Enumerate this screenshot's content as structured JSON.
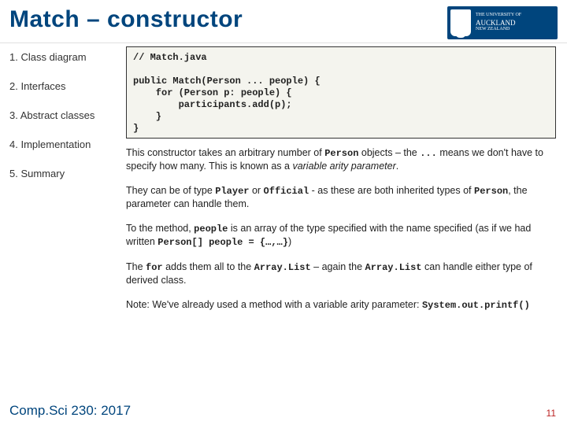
{
  "header": {
    "title": "Match – constructor",
    "logo_line1": "THE UNIVERSITY OF",
    "logo_line2": "AUCKLAND",
    "logo_line3": "NEW ZEALAND"
  },
  "sidebar": {
    "items": [
      "1. Class diagram",
      "2. Interfaces",
      "3. Abstract classes",
      "4. Implementation",
      "5. Summary"
    ]
  },
  "code": {
    "text": "// Match.java\n\npublic Match(Person ... people) {\n    for (Person p: people) {\n        participants.add(p);\n    }\n}"
  },
  "paragraphs": {
    "p1_a": "This constructor takes an arbitrary number of ",
    "p1_code1": "Person",
    "p1_b": " objects – the ",
    "p1_code2": "...",
    "p1_c": " means we don't have to specify how many. This is known as a ",
    "p1_em": "variable arity parameter",
    "p1_d": ".",
    "p2_a": "They can be of type ",
    "p2_code1": "Player",
    "p2_b": " or ",
    "p2_code2": "Official",
    "p2_c": " - as these are both inherited types of ",
    "p2_code3": "Person",
    "p2_d": ", the parameter can handle them.",
    "p3_a": "To the method, ",
    "p3_code1": "people",
    "p3_b": " is an array of the type specified with the name specified (as if we had written ",
    "p3_code2": "Person[] people = {…,…}",
    "p3_c": ")",
    "p4_a": "The ",
    "p4_code1": "for",
    "p4_b": " adds them all to the ",
    "p4_code2": "Array.List",
    "p4_c": " – again the ",
    "p4_code3": "Array.List",
    "p4_d": " can handle either type of derived class.",
    "p5_a": "Note: We've already used a method with a variable arity parameter: ",
    "p5_code1": "System.out.printf()"
  },
  "footer": {
    "course": "Comp.Sci 230: 2017",
    "page": "11"
  }
}
